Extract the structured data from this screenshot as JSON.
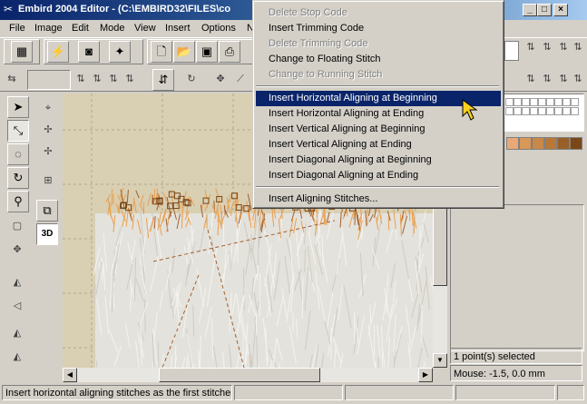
{
  "window": {
    "title": "Embird 2004 Editor - (C:\\EMBIRD32\\FILES\\co"
  },
  "menubar": {
    "items": [
      "File",
      "Image",
      "Edit",
      "Mode",
      "View",
      "Insert",
      "Options",
      "N"
    ]
  },
  "context_menu": {
    "items_group1": [
      {
        "label": "Delete Stop Code",
        "disabled": true
      },
      {
        "label": "Insert Trimming Code",
        "disabled": false
      },
      {
        "label": "Delete Trimming Code",
        "disabled": true
      },
      {
        "label": "Change to Floating Stitch",
        "disabled": false
      },
      {
        "label": "Change to Running Stitch",
        "disabled": true
      }
    ],
    "items_group2": [
      {
        "label": "Insert Horizontal Aligning at Beginning",
        "highlighted": true
      },
      {
        "label": "Insert Horizontal Aligning at Ending"
      },
      {
        "label": "Insert Vertical Aligning at Beginning"
      },
      {
        "label": "Insert Vertical Aligning at Ending"
      },
      {
        "label": "Insert Diagonal Aligning at Beginning"
      },
      {
        "label": "Insert Diagonal Aligning at Ending"
      }
    ],
    "items_group3": [
      {
        "label": "Insert Aligning Stitches..."
      }
    ]
  },
  "toolbar": {
    "view_3d_label": "3D"
  },
  "right_panel": {
    "points_selected": "1 point(s) selected",
    "mouse_readout": "Mouse: -1.5, 0.0 mm",
    "swatch_colors": [
      "#e8a878",
      "#d89858",
      "#c88848",
      "#b87838",
      "#986028",
      "#7a4818"
    ]
  },
  "statusbar": {
    "hint": "Insert horizontal aligning stitches as the first stitches o"
  },
  "colors": {
    "menu_highlight": "#0a246a",
    "canvas_bg": "#d9cfb3",
    "stitch_orange": "#e8a050"
  }
}
